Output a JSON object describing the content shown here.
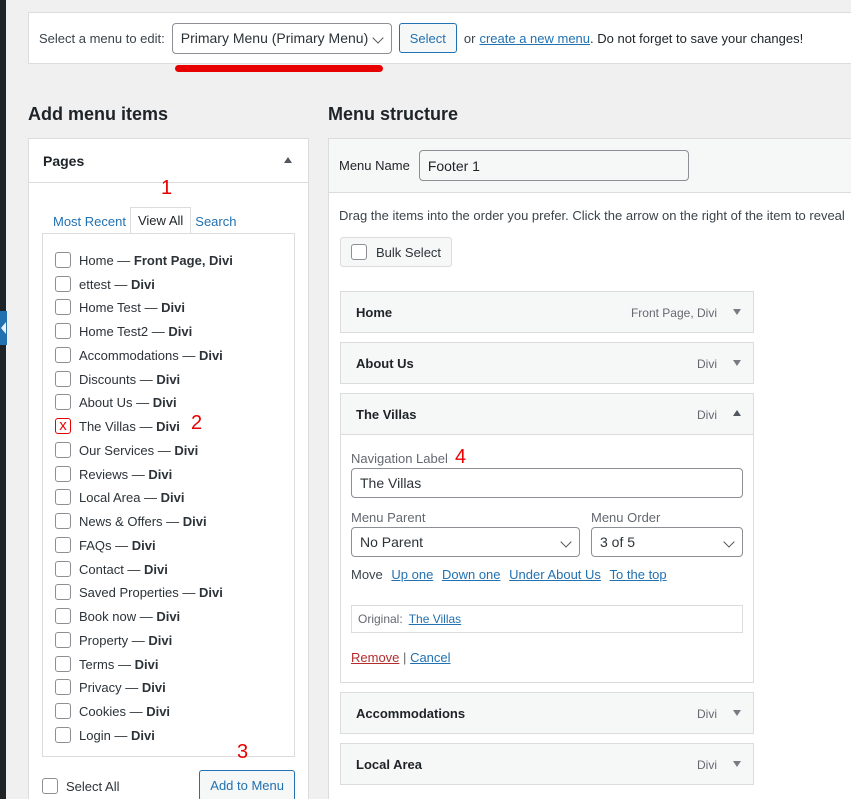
{
  "select_bar": {
    "label": "Select a menu to edit:",
    "menu_value": "Primary Menu (Primary Menu)",
    "select_button": "Select",
    "or_text": "or",
    "create_link": "create a new menu",
    "save_reminder": ". Do not forget to save your changes!"
  },
  "add_items": {
    "heading": "Add menu items",
    "pages_title": "Pages",
    "tabs": [
      "Most Recent",
      "View All",
      "Search"
    ],
    "active_tab": "View All",
    "pages": [
      {
        "name": "Home",
        "tag": "Front Page, Divi",
        "checked": false
      },
      {
        "name": "ettest",
        "tag": "Divi",
        "checked": false
      },
      {
        "name": "Home Test",
        "tag": "Divi",
        "checked": false
      },
      {
        "name": "Home Test2",
        "tag": "Divi",
        "checked": false
      },
      {
        "name": "Accommodations",
        "tag": "Divi",
        "checked": false
      },
      {
        "name": "Discounts",
        "tag": "Divi",
        "checked": false
      },
      {
        "name": "About Us",
        "tag": "Divi",
        "checked": false
      },
      {
        "name": "The Villas",
        "tag": "Divi",
        "checked": true
      },
      {
        "name": "Our Services",
        "tag": "Divi",
        "checked": false
      },
      {
        "name": "Reviews",
        "tag": "Divi",
        "checked": false
      },
      {
        "name": "Local Area",
        "tag": "Divi",
        "checked": false
      },
      {
        "name": "News & Offers",
        "tag": "Divi",
        "checked": false
      },
      {
        "name": "FAQs",
        "tag": "Divi",
        "checked": false
      },
      {
        "name": "Contact",
        "tag": "Divi",
        "checked": false
      },
      {
        "name": "Saved Properties",
        "tag": "Divi",
        "checked": false
      },
      {
        "name": "Book now",
        "tag": "Divi",
        "checked": false
      },
      {
        "name": "Property",
        "tag": "Divi",
        "checked": false
      },
      {
        "name": "Terms",
        "tag": "Divi",
        "checked": false
      },
      {
        "name": "Privacy",
        "tag": "Divi",
        "checked": false
      },
      {
        "name": "Cookies",
        "tag": "Divi",
        "checked": false
      },
      {
        "name": "Login",
        "tag": "Divi",
        "checked": false
      }
    ],
    "select_all": "Select All",
    "add_button": "Add to Menu"
  },
  "structure": {
    "heading": "Menu structure",
    "menu_name_label": "Menu Name",
    "menu_name_value": "Footer 1",
    "drag_hint": "Drag the items into the order you prefer. Click the arrow on the right of the item to reveal",
    "bulk_select": "Bulk Select",
    "items": [
      {
        "title": "Home",
        "meta": "Front Page, Divi"
      },
      {
        "title": "About Us",
        "meta": "Divi"
      },
      {
        "title": "The Villas",
        "meta": "Divi"
      },
      {
        "title": "Accommodations",
        "meta": "Divi"
      },
      {
        "title": "Local Area",
        "meta": "Divi"
      }
    ],
    "expanded": {
      "nav_label_title": "Navigation Label",
      "nav_label_value": "The Villas",
      "parent_title": "Menu Parent",
      "parent_value": "No Parent",
      "order_title": "Menu Order",
      "order_value": "3 of 5",
      "move_label": "Move",
      "move_links": [
        "Up one",
        "Down one",
        "Under About Us",
        "To the top"
      ],
      "original_label": "Original:",
      "original_link": "The Villas",
      "remove": "Remove",
      "separator": "|",
      "cancel": "Cancel"
    }
  },
  "annotations": [
    "1",
    "2",
    "3",
    "4"
  ],
  "colors": {
    "accent": "#2271b1",
    "annotation": "#e80000",
    "remove": "#b32d2e"
  }
}
